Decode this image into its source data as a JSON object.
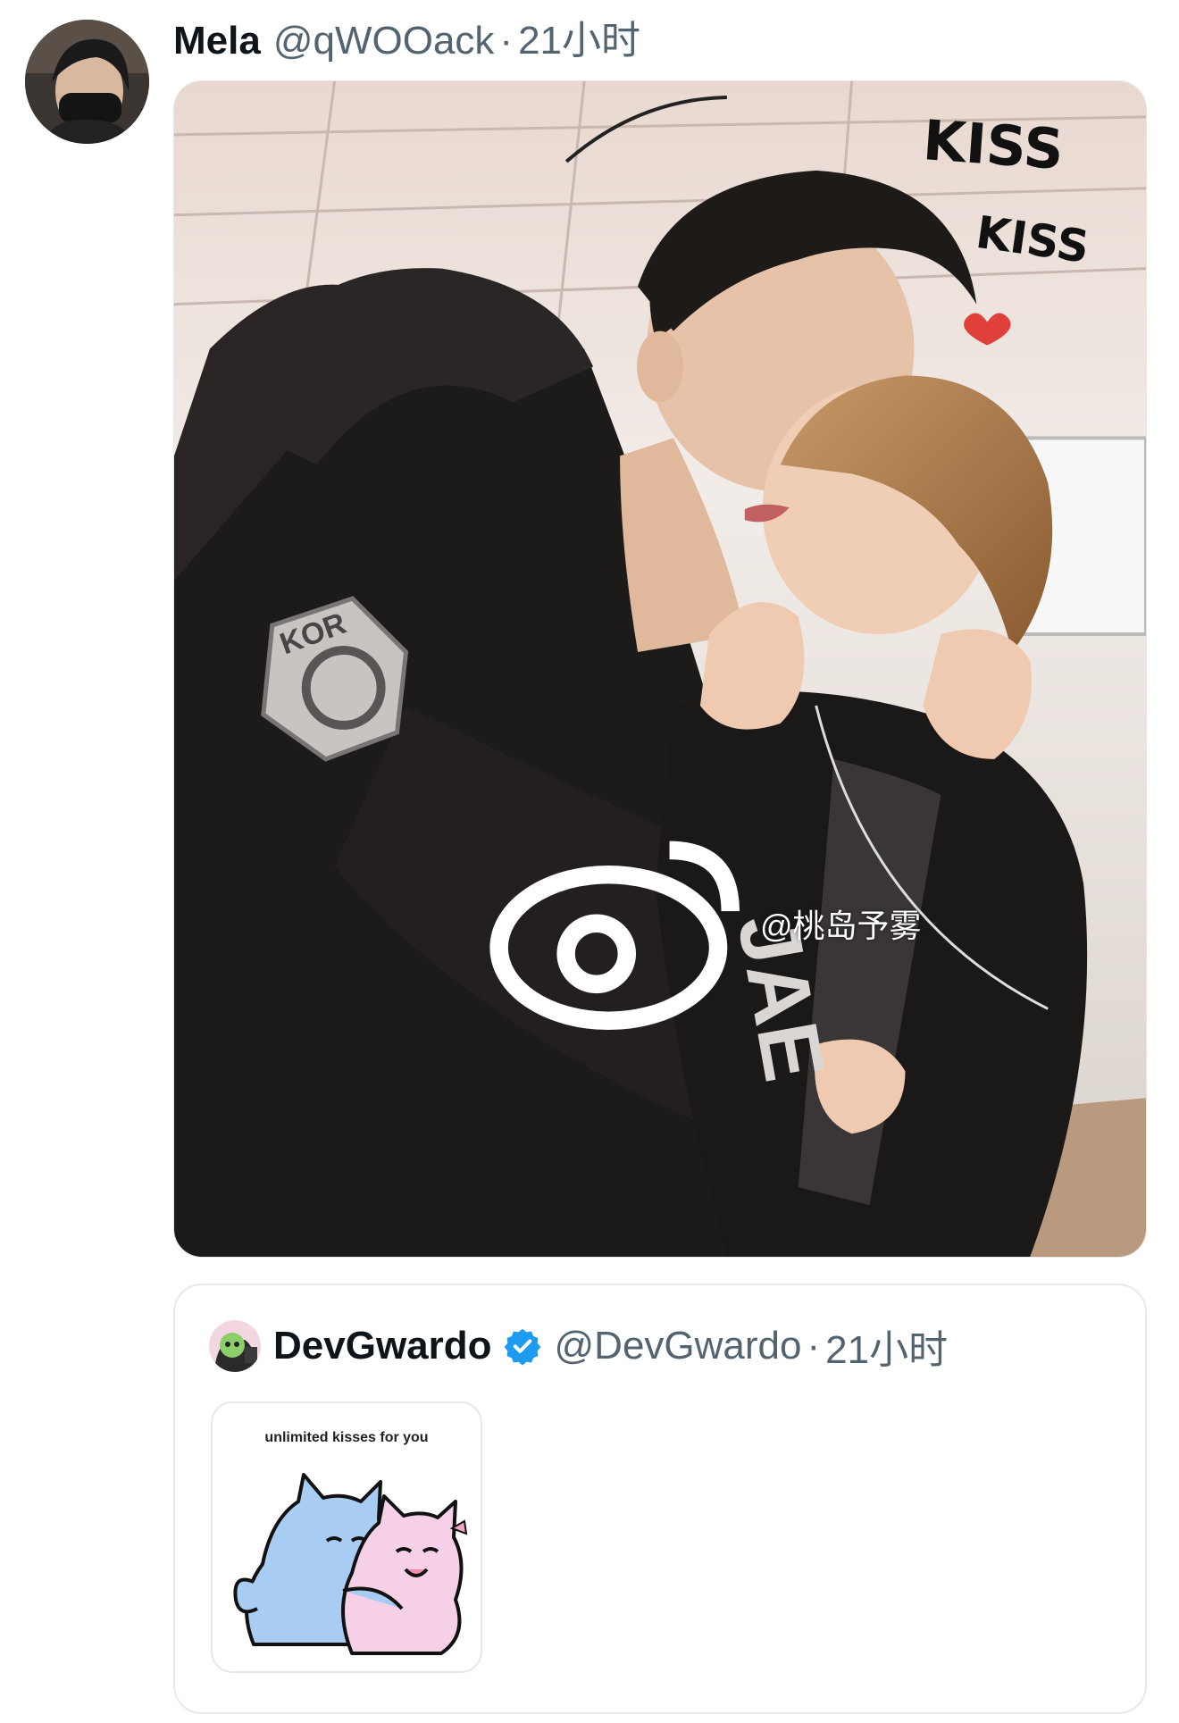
{
  "tweet": {
    "author_name": "Mela",
    "author_handle": "@qWOOack",
    "separator": "·",
    "time": "21小时",
    "avatar_icon": "user-avatar",
    "media": {
      "description_icon": "comic-illustration",
      "watermark_icon": "weibo-icon",
      "watermark_text": "@桃岛予雾",
      "sfx_1": "KISS",
      "sfx_2": "KISS",
      "sleeve_patch": "KOR",
      "back_text": "JAE"
    }
  },
  "quote": {
    "author_name": "DevGwardo",
    "verified_icon": "verified-badge-icon",
    "verified_color": "#1d9bf0",
    "author_handle": "@DevGwardo",
    "separator": "·",
    "time": "21小时",
    "media_caption": "unlimited kisses for you",
    "media_icon": "cats-hugging-sticker"
  },
  "colors": {
    "text_primary": "#0f1419",
    "text_secondary": "#536471",
    "border": "#e6e9ec"
  }
}
